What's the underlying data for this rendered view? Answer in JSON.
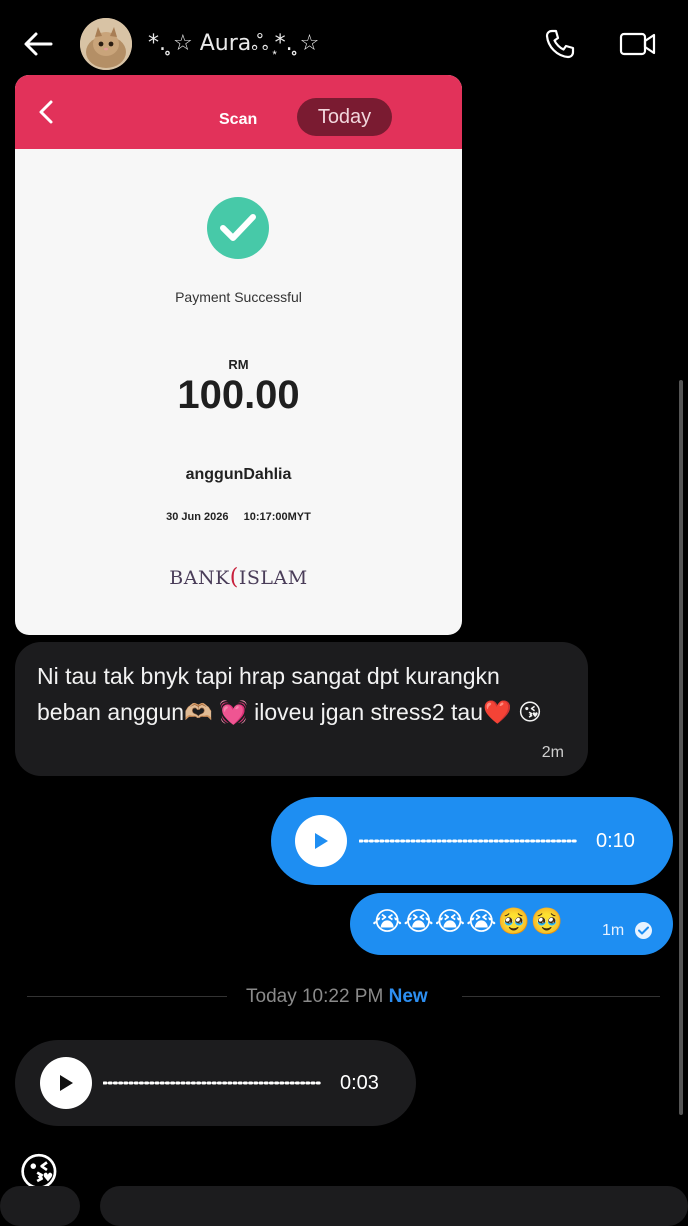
{
  "header": {
    "back_icon": "arrow-left-icon",
    "contact_name": "*. ̥☆ Auraஃ ͙*. ̥☆",
    "call_icon": "phone-icon",
    "video_icon": "video-camera-icon"
  },
  "messages": {
    "receipt": {
      "header_title": "Scan",
      "header_badge": "Today",
      "status": "Payment Successful",
      "currency": "RM",
      "amount": "100.00",
      "payee": "anggunDahlia",
      "date": "30 Jun 2026",
      "time": "10:17:00MYT",
      "bank_name_left": "BANK",
      "bank_name_right": "ISLAM",
      "accent_color": "#e2325a"
    },
    "incoming_text": {
      "text": "Ni tau tak bnyk tapi hrap sangat dpt kurangkn beban anggun🫶🏼 💓 iloveu jgan stress2 tau❤️ 😘",
      "time": "2m"
    },
    "outgoing_voice": {
      "duration": "0:10"
    },
    "outgoing_emojis": {
      "emojis": "😭😭😭😭🥹🥹",
      "time": "1m"
    },
    "divider": {
      "label": "Today 10:22 PM",
      "new_label": "New"
    },
    "incoming_voice": {
      "duration": "0:03"
    },
    "partial_emoji": "😘"
  },
  "colors": {
    "outgoing_bubble": "#1e8ef2",
    "incoming_bubble": "#1c1c1e",
    "new_label": "#2d8ef0",
    "check_circle": "#47c9a8"
  }
}
